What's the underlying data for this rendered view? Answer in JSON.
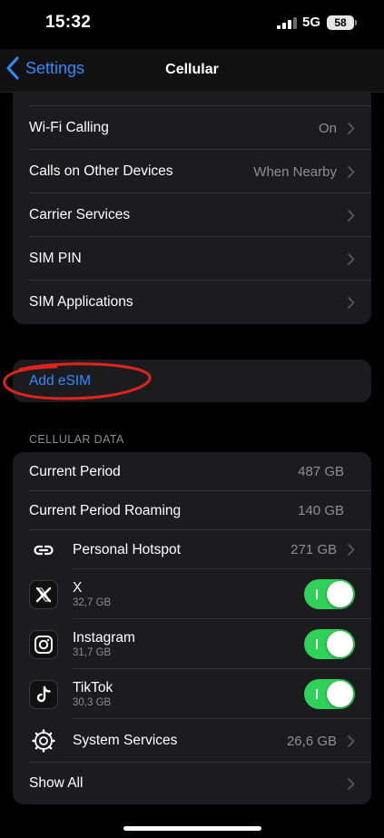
{
  "status_bar": {
    "time": "15:32",
    "network": "5G",
    "battery": "58"
  },
  "nav": {
    "back_label": "Settings",
    "title": "Cellular"
  },
  "top_group": {
    "rows": [
      {
        "label": "Wi-Fi Calling",
        "value": "On"
      },
      {
        "label": "Calls on Other Devices",
        "value": "When Nearby"
      },
      {
        "label": "Carrier Services",
        "value": ""
      },
      {
        "label": "SIM PIN",
        "value": ""
      },
      {
        "label": "SIM Applications",
        "value": ""
      }
    ]
  },
  "esim": {
    "label": "Add eSIM",
    "highlight_color": "#e0231d"
  },
  "cellular_data": {
    "header": "CELLULAR DATA",
    "current_period": {
      "label": "Current Period",
      "value": "487 GB"
    },
    "current_period_roaming": {
      "label": "Current Period Roaming",
      "value": "140 GB"
    },
    "hotspot": {
      "label": "Personal Hotspot",
      "value": "271 GB",
      "icon": "link-icon"
    },
    "apps": [
      {
        "name": "X",
        "usage": "32,7 GB",
        "enabled": true,
        "icon": "x-logo-icon"
      },
      {
        "name": "Instagram",
        "usage": "31,7 GB",
        "enabled": true,
        "icon": "instagram-icon"
      },
      {
        "name": "TikTok",
        "usage": "30,3 GB",
        "enabled": true,
        "icon": "tiktok-icon"
      }
    ],
    "system_services": {
      "label": "System Services",
      "value": "26,6 GB",
      "icon": "gear-icon"
    },
    "show_all": "Show All"
  },
  "colors": {
    "accent": "#2f8bff",
    "toggle_on": "#30d158",
    "cell_bg": "#1c1c1e",
    "secondary_text": "#8e8e93"
  }
}
